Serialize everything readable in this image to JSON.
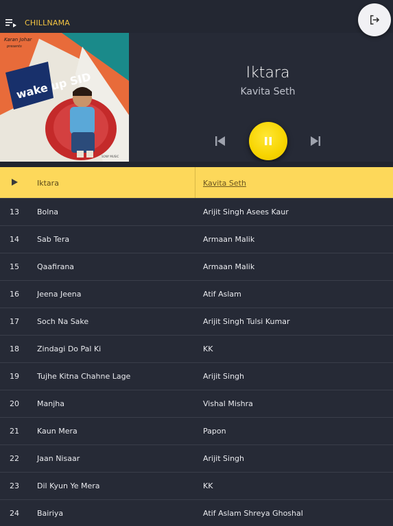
{
  "app": {
    "title": "CHILLNAMA"
  },
  "now_playing": {
    "title": "Iktara",
    "artist": "Kavita Seth",
    "cover": {
      "presenter": "Karan Johar",
      "presents": "presents",
      "album": "wake up SID",
      "label": "SONY MUSIC"
    }
  },
  "tracks": [
    {
      "num": "13",
      "title": "Bolna",
      "artist": "Arijit Singh Asees Kaur"
    },
    {
      "num": "14",
      "title": "Sab Tera",
      "artist": "Armaan Malik"
    },
    {
      "num": "15",
      "title": "Qaafirana",
      "artist": "Armaan Malik"
    },
    {
      "num": "16",
      "title": "Jeena Jeena",
      "artist": "Atif Aslam"
    },
    {
      "num": "17",
      "title": "Soch Na Sake",
      "artist": "Arijit Singh Tulsi Kumar"
    },
    {
      "num": "18",
      "title": "Zindagi Do Pal Ki",
      "artist": "KK"
    },
    {
      "num": "19",
      "title": "Tujhe Kitna Chahne Lage",
      "artist": "Arijit Singh"
    },
    {
      "num": "20",
      "title": "Manjha",
      "artist": "Vishal Mishra"
    },
    {
      "num": "21",
      "title": "Kaun Mera",
      "artist": "Papon"
    },
    {
      "num": "22",
      "title": "Jaan Nisaar",
      "artist": "Arijit Singh"
    },
    {
      "num": "23",
      "title": "Dil Kyun Ye Mera",
      "artist": "KK"
    },
    {
      "num": "24",
      "title": "Bairiya",
      "artist": "Atif Aslam Shreya Ghoshal"
    }
  ],
  "colors": {
    "accent": "#f5c542",
    "active_row": "#fdd85a",
    "play_button": "#f7d400",
    "background": "#262a36"
  }
}
